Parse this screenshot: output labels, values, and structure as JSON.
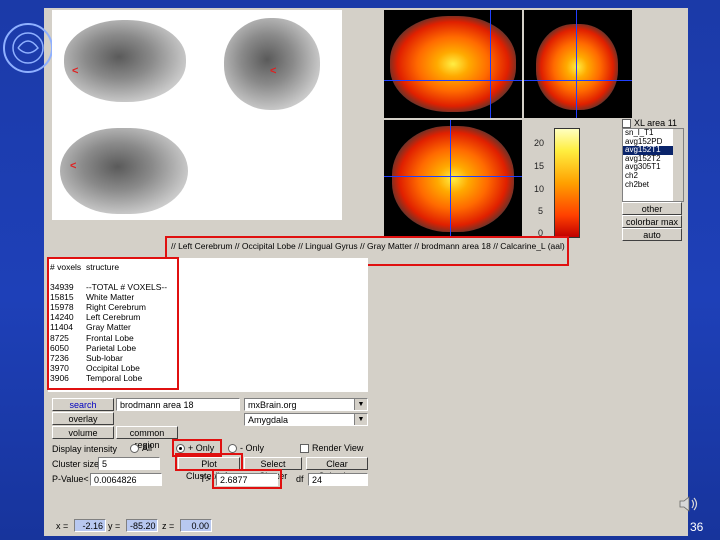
{
  "slide_number": "36",
  "viewer": {
    "structure_path": "// Left Cerebrum // Occipital Lobe // Lingual Gyrus // Gray Matter // brodmann area 18 // Calcarine_L (aal)",
    "left_marks": [
      "<",
      "<",
      "<"
    ],
    "colorbar_ticks": [
      "20",
      "15",
      "10",
      "5",
      "0"
    ],
    "checkbox_label": "XL area 11",
    "template_list": [
      "sn_l_T1",
      "avg152PD",
      "avg152T1",
      "avg152T2",
      "avg305T1",
      "ch2",
      "ch2bet"
    ],
    "template_selected": "avg152T1",
    "other_button": "other",
    "colorbar_max_button": "colorbar max",
    "auto_button": "auto"
  },
  "table": {
    "headers": [
      "# voxels",
      "structure"
    ],
    "rows": [
      [
        "34939",
        "--TOTAL # VOXELS--"
      ],
      [
        "15815",
        "White Matter"
      ],
      [
        "15978",
        "Right Cerebrum"
      ],
      [
        "14240",
        "Left Cerebrum"
      ],
      [
        "11404",
        "Gray Matter"
      ],
      [
        "8725",
        "Frontal Lobe"
      ],
      [
        "6050",
        "Parietal Lobe"
      ],
      [
        "7236",
        "Sub-lobar"
      ],
      [
        "3970",
        "Occipital Lobe"
      ],
      [
        "3906",
        "Temporal Lobe"
      ]
    ]
  },
  "controls": {
    "search_button": "search",
    "search_value": "brodmann area 18",
    "db_value": "mxBrain.org",
    "overlay_button": "overlay",
    "overlay_value": "Amygdala",
    "volume_button": "volume",
    "common_region_button": "common region",
    "display_intensity_label": "Display intensity",
    "radio_all": "All",
    "radio_only_pos": "+ Only",
    "radio_only_neg": "- Only",
    "render_view_label": "Render View",
    "cluster_size_label": "Cluster size >=",
    "cluster_size_value": "5",
    "plot_cluster_button": "Plot Cluster/Info",
    "select_cluster_button": "Select Cluster",
    "clear_selection_button": "Clear Selection",
    "pvalue_label": "P-Value<",
    "pvalue_value": "0.0064826",
    "t_label": "T>",
    "t_value": "2.6877",
    "df_label": "df",
    "df_value": "24",
    "coord_x_label": "x =",
    "coord_x_value": "-2.16",
    "coord_y_label": "y =",
    "coord_y_value": "-85.20",
    "coord_z_label": "z =",
    "coord_z_value": "0.00"
  }
}
